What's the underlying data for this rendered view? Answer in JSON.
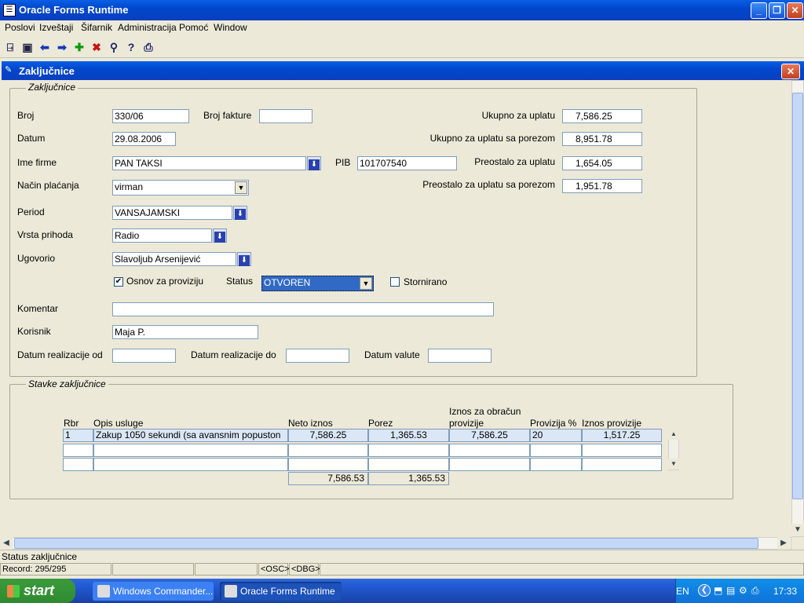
{
  "window": {
    "title": "Oracle Forms Runtime",
    "minimize": "_",
    "maximize": "❐",
    "close": "✕"
  },
  "menu": [
    "Poslovi",
    "Izveštaji",
    "Šifarnik",
    "Administracija",
    "Pomoć",
    "Window"
  ],
  "toolbar": {
    "icons": [
      "exit-icon",
      "save-icon",
      "previous-record-icon",
      "next-record-icon",
      "insert-record-icon",
      "delete-record-icon",
      "query-icon",
      "help-icon",
      "print-icon"
    ]
  },
  "form": {
    "title": "Zaključnice",
    "header_frame_title": "Zaključnice",
    "labels": {
      "broj": "Broj",
      "broj_fakture": "Broj fakture",
      "datum": "Datum",
      "ime_firme": "Ime firme",
      "pib": "PIB",
      "nacin_placanja": "Način plaćanja",
      "period": "Period",
      "vrsta_prihoda": "Vrsta prihoda",
      "ugovorio": "Ugovorio",
      "osnov_za_proviziju": "Osnov za proviziju",
      "status": "Status",
      "stornirano": "Stornirano",
      "komentar": "Komentar",
      "korisnik": "Korisnik",
      "datum_realizacije_od": "Datum realizacije od",
      "datum_realizacije_do": "Datum realizacije do",
      "datum_valute": "Datum valute",
      "ukupno_za_uplatu": "Ukupno za uplatu",
      "ukupno_za_uplatu_sa_porezom": "Ukupno za uplatu sa porezom",
      "preostalo_za_uplatu": "Preostalo za uplatu",
      "preostalo_za_uplatu_sa_porezom": "Preostalo za uplatu sa porezom"
    },
    "values": {
      "broj": "330/06",
      "broj_fakture": "",
      "datum": "29.08.2006",
      "ime_firme": "PAN TAKSI",
      "pib": "101707540",
      "nacin_placanja": "virman",
      "period": "VANSAJAMSKI",
      "vrsta_prihoda": "Radio",
      "ugovorio": "Slavoljub Arsenijević",
      "osnov_za_proviziju_check": "✔",
      "status": "OTVOREN",
      "komentar": "",
      "korisnik": "Maja P.",
      "datum_realizacije_od": "",
      "datum_realizacije_do": "",
      "datum_valute": "",
      "ukupno_za_uplatu": "7,586.25",
      "ukupno_za_uplatu_sa_porezom": "8,951.78",
      "preostalo_za_uplatu": "1,654.05",
      "preostalo_za_uplatu_sa_porezom": "1,951.78"
    }
  },
  "items": {
    "frame_title": "Stavke zaključnice",
    "columns": {
      "rbr": "Rbr",
      "opis": "Opis usluge",
      "neto": "Neto iznos",
      "porez": "Porez",
      "iznos_obracun_1": "Iznos za obračun",
      "iznos_obracun_2": "provizije",
      "provizija_pct": "Provizija %",
      "iznos_provizije": "Iznos provizije"
    },
    "rows": [
      {
        "rbr": "1",
        "opis": "Zakup 1050 sekundi (sa avansnim popuston",
        "neto": "7,586.25",
        "porez": "1,365.53",
        "iznos_obracun": "7,586.25",
        "provizija_pct": "20",
        "iznos_provizije": "1,517.25"
      },
      {
        "rbr": "",
        "opis": "",
        "neto": "",
        "porez": "",
        "iznos_obracun": "",
        "provizija_pct": "",
        "iznos_provizije": ""
      },
      {
        "rbr": "",
        "opis": "",
        "neto": "",
        "porez": "",
        "iznos_obracun": "",
        "provizija_pct": "",
        "iznos_provizije": ""
      }
    ],
    "totals": {
      "neto": "7,586.53",
      "porez": "1,365.53"
    }
  },
  "status": {
    "message": "Status zaključnice",
    "record": "Record: 295/295",
    "osc": "<OSC>",
    "dbg": "<DBG>"
  },
  "taskbar": {
    "start": "start",
    "tasks": [
      "Windows Commander...",
      "Oracle Forms Runtime"
    ],
    "lang": "EN",
    "clock": "17:33"
  }
}
